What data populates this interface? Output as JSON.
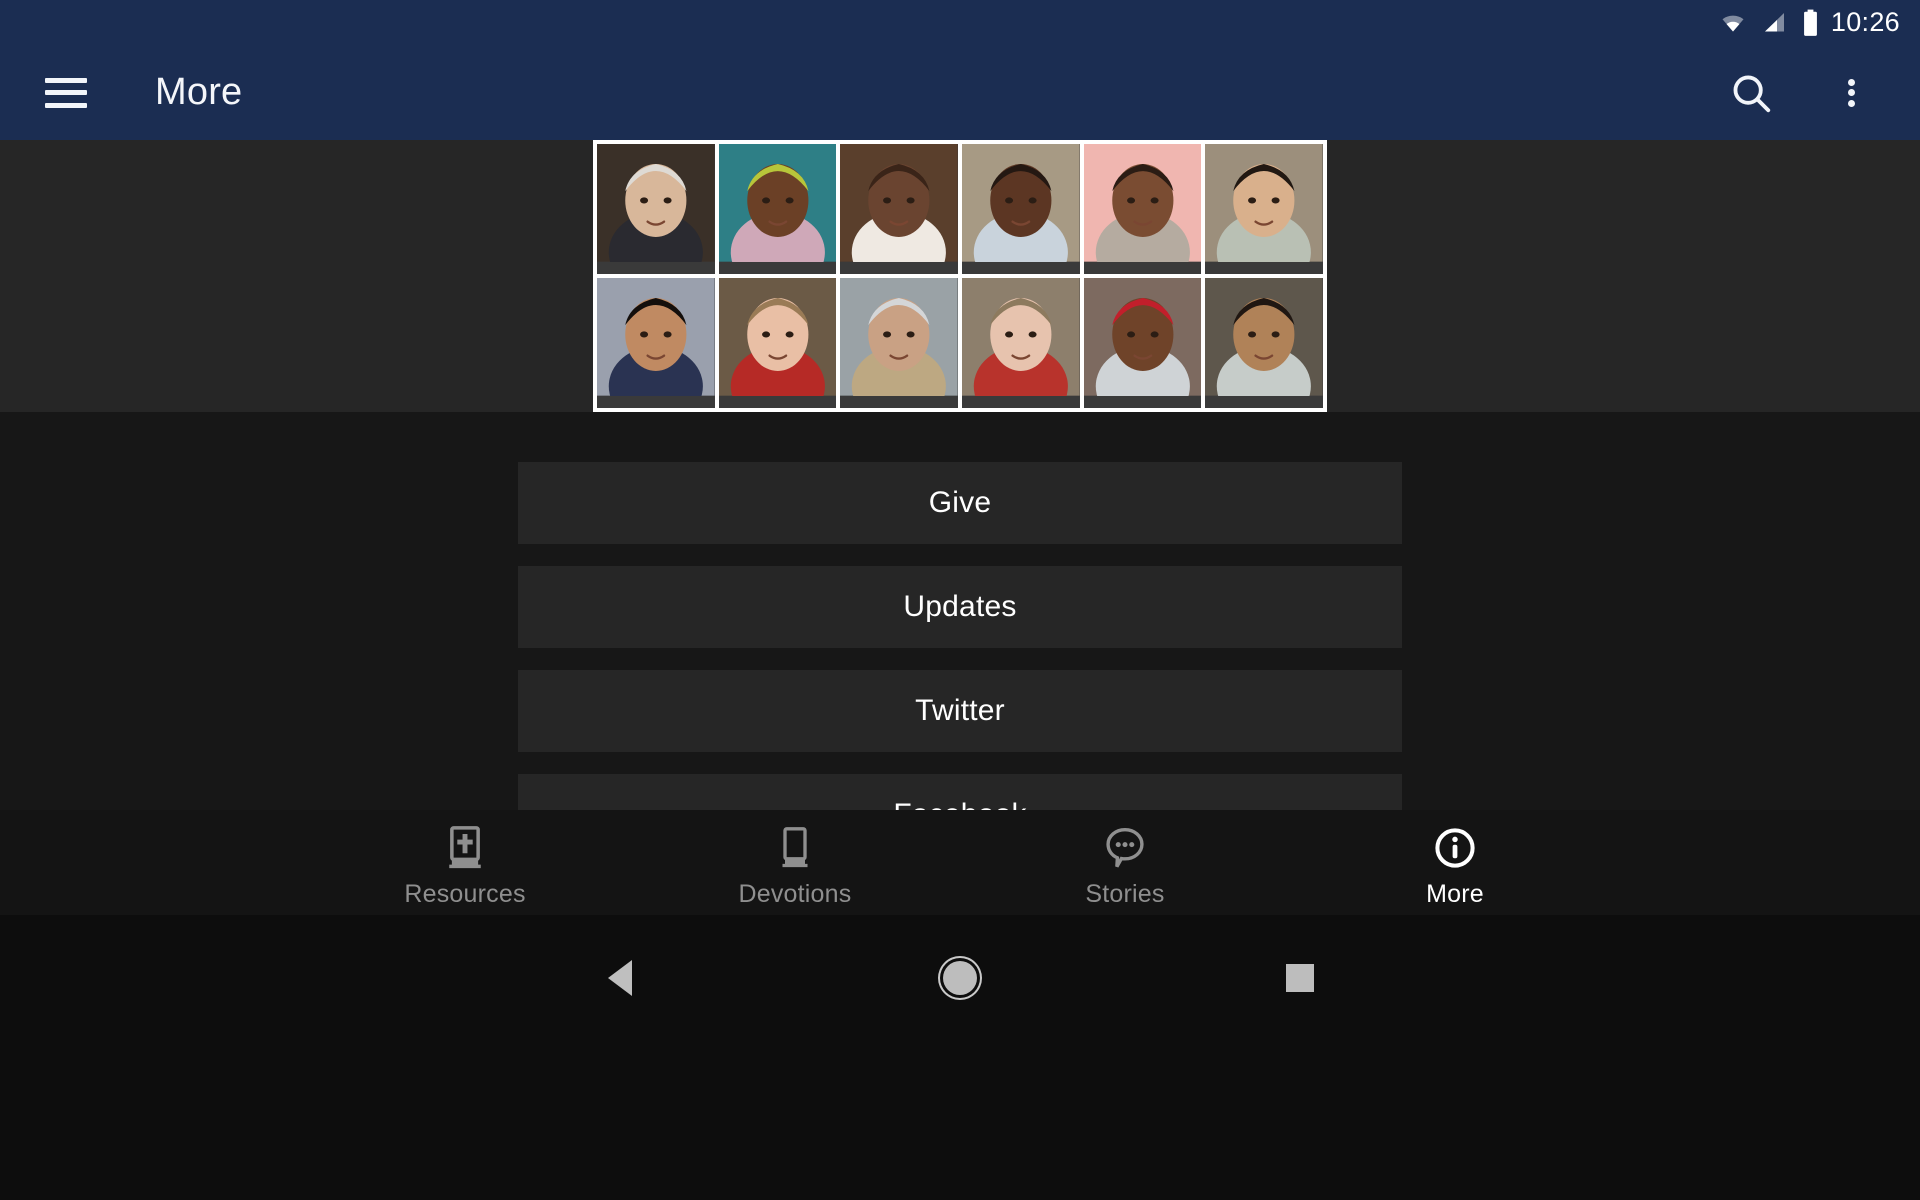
{
  "statusbar": {
    "time": "10:26",
    "icons": [
      "wifi-icon",
      "cellular-signal-icon",
      "battery-icon"
    ]
  },
  "appbar": {
    "menu_icon": "hamburger-menu-icon",
    "title": "More",
    "search_icon": "search-icon",
    "overflow_icon": "overflow-menu-icon",
    "background_color": "#1b2d52"
  },
  "hero": {
    "name": "photo-collage-banner",
    "background_color": "#262626",
    "border_color": "#ffffff",
    "rows": 2,
    "columns": 6,
    "photos": [
      {
        "alt": "elderly-woman-headscarf",
        "bg": "#3a3028",
        "skin": "#d8b79a",
        "hair": "#dedad4",
        "cloth": "#2a2a30"
      },
      {
        "alt": "child-green-hood-with-cup",
        "bg": "#2e7f86",
        "skin": "#6b4026",
        "hair": "#b8c63a",
        "cloth": "#cfa8b8"
      },
      {
        "alt": "girl-braids-beads",
        "bg": "#5a3f2c",
        "skin": "#6a4430",
        "hair": "#3a2418",
        "cloth": "#efe9e2"
      },
      {
        "alt": "boy-eating-meal",
        "bg": "#a79a84",
        "skin": "#5c3623",
        "hair": "#241812",
        "cloth": "#c9d3dc"
      },
      {
        "alt": "man-portrait-pink-wall",
        "bg": "#f0b6b0",
        "skin": "#7a4c32",
        "hair": "#2b1c14",
        "cloth": "#b5aba0"
      },
      {
        "alt": "boy-eating-with-bowl",
        "bg": "#9c8f7c",
        "skin": "#d9b08c",
        "hair": "#211812",
        "cloth": "#b9c0b4"
      },
      {
        "alt": "girl-pigtails-blue-bows",
        "bg": "#9aa0ad",
        "skin": "#c08a62",
        "hair": "#140f0c",
        "cloth": "#2a3352"
      },
      {
        "alt": "baby-red-shirt",
        "bg": "#6b5a46",
        "skin": "#e9bfa5",
        "hair": "#9a7b56",
        "cloth": "#b62a26"
      },
      {
        "alt": "elderly-woman-with-bread",
        "bg": "#9aa2a6",
        "skin": "#c9a184",
        "hair": "#d4d6d8",
        "cloth": "#bda882"
      },
      {
        "alt": "boy-holding-child",
        "bg": "#8d7f6c",
        "skin": "#e7c3ae",
        "hair": "#8d7a5e",
        "cloth": "#b8332c"
      },
      {
        "alt": "man-red-cap",
        "bg": "#7d6a60",
        "skin": "#6f4329",
        "hair": "#c21f2b",
        "cloth": "#cfd3d6"
      },
      {
        "alt": "child-eating-rice",
        "bg": "#5e574c",
        "skin": "#b08258",
        "hair": "#201712",
        "cloth": "#c6ccc9"
      }
    ]
  },
  "menu": {
    "items": [
      {
        "label": "Give"
      },
      {
        "label": "Updates"
      },
      {
        "label": "Twitter"
      },
      {
        "label": "Facebook"
      }
    ]
  },
  "tabbar": {
    "tabs": [
      {
        "label": "Resources",
        "icon": "bible-book-icon",
        "active": false
      },
      {
        "label": "Devotions",
        "icon": "book-icon",
        "active": false
      },
      {
        "label": "Stories",
        "icon": "speech-bubble-icon",
        "active": false
      },
      {
        "label": "More",
        "icon": "info-circle-icon",
        "active": true
      }
    ],
    "active_color": "#ffffff",
    "inactive_color": "#8f8f8f"
  },
  "navbar": {
    "buttons": [
      {
        "name": "back",
        "icon": "back-triangle-icon"
      },
      {
        "name": "home",
        "icon": "home-circle-icon"
      },
      {
        "name": "recents",
        "icon": "recents-square-icon"
      }
    ]
  }
}
